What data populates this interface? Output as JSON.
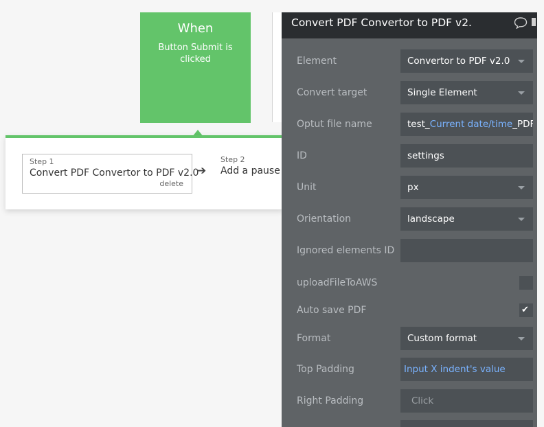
{
  "trigger": {
    "title": "When",
    "subtitle": "Button Submit is clicked"
  },
  "steps": [
    {
      "number": "Step 1",
      "text": "Convert PDF Convertor to PDF v2.0",
      "delete_label": "delete"
    },
    {
      "number": "Step 2",
      "text": "Add a pause b"
    }
  ],
  "editor": {
    "title": "Convert PDF Convertor to PDF v2.",
    "icons": {
      "comment": "speech-bubble-icon",
      "dropdown": "chevron-down-icon",
      "check": "checkmark-icon",
      "step_arrow": "arrow-right-icon"
    },
    "fields": {
      "element": {
        "label": "Element",
        "value": "Convertor to PDF v2.0"
      },
      "convert_target": {
        "label": "Convert target",
        "value": "Single Element"
      },
      "output_file_name": {
        "label": "Optut file name",
        "prefix": "test_",
        "dynamic": "Current date/time",
        "suffix": "_PDF"
      },
      "id": {
        "label": "ID",
        "value": "settings"
      },
      "unit": {
        "label": "Unit",
        "value": "px"
      },
      "orientation": {
        "label": "Orientation",
        "value": "landscape"
      },
      "ignored_elements_id": {
        "label": "Ignored elements ID",
        "value": ""
      },
      "upload_file_to_aws": {
        "label": "uploadFileToAWS",
        "checked": false
      },
      "auto_save_pdf": {
        "label": "Auto save PDF",
        "checked": true
      },
      "format": {
        "label": "Format",
        "value": "Custom format"
      },
      "top_padding": {
        "label": "Top Padding",
        "dynamic": "Input X indent's value"
      },
      "right_padding": {
        "label": "Right Padding",
        "placeholder": "Click"
      }
    }
  },
  "colors": {
    "trigger_green": "#63c46a",
    "editor_bg": "#5f6366",
    "editor_header": "#2a2d30",
    "field_bg": "#4c5155",
    "dynamic_text": "#7ab3ff"
  }
}
